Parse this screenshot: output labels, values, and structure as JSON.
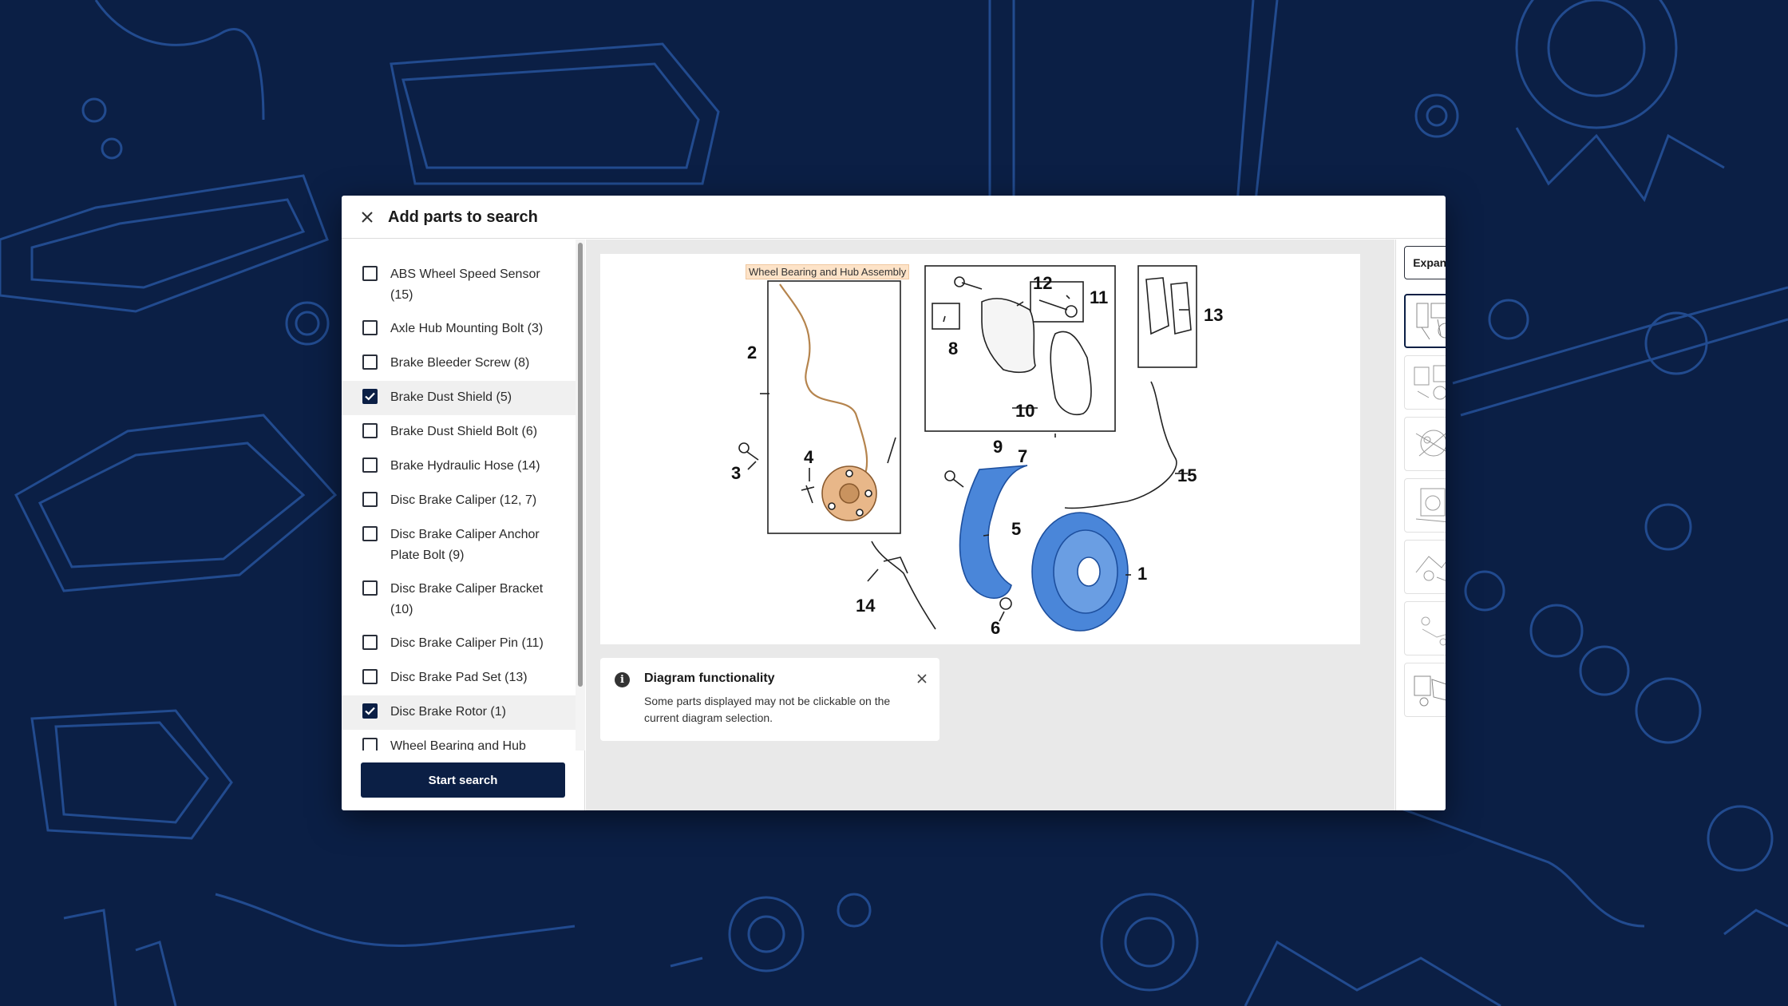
{
  "modal": {
    "title": "Add parts to search",
    "start_button": "Start search"
  },
  "parts": [
    {
      "label": "ABS Wheel Speed Sensor (15)",
      "checked": false
    },
    {
      "label": "Axle Hub Mounting Bolt (3)",
      "checked": false
    },
    {
      "label": "Brake Bleeder Screw (8)",
      "checked": false
    },
    {
      "label": "Brake Dust Shield (5)",
      "checked": true
    },
    {
      "label": "Brake Dust Shield Bolt (6)",
      "checked": false
    },
    {
      "label": "Brake Hydraulic Hose (14)",
      "checked": false
    },
    {
      "label": "Disc Brake Caliper (12, 7)",
      "checked": false
    },
    {
      "label": "Disc Brake Caliper Anchor Plate Bolt (9)",
      "checked": false
    },
    {
      "label": "Disc Brake Caliper Bracket (10)",
      "checked": false
    },
    {
      "label": "Disc Brake Caliper Pin (11)",
      "checked": false
    },
    {
      "label": "Disc Brake Pad Set (13)",
      "checked": false
    },
    {
      "label": "Disc Brake Rotor (1)",
      "checked": true
    },
    {
      "label": "Wheel Bearing and Hub",
      "checked": false
    }
  ],
  "diagram": {
    "hover_label": "Wheel Bearing and Hub Assembly",
    "callouts": [
      "1",
      "2",
      "3",
      "4",
      "5",
      "6",
      "7",
      "8",
      "9",
      "10",
      "11",
      "12",
      "13",
      "14",
      "15"
    ]
  },
  "notice": {
    "icon": "info-icon",
    "title": "Diagram functionality",
    "body": "Some parts displayed may not be clickable on the current diagram selection."
  },
  "right_panel": {
    "expand_label": "Expand",
    "thumbnail_count": 7,
    "active_thumbnail": 1
  },
  "colors": {
    "background": "#0b1f45",
    "primary": "#0b1f45",
    "highlight_blue": "#4a86d9",
    "highlight_orange": "#d9a070"
  }
}
